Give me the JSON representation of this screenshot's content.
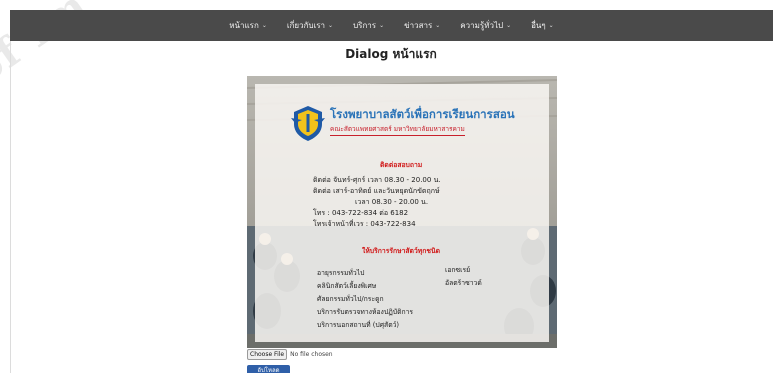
{
  "navbar": {
    "items": [
      {
        "label": "หน้าแรก",
        "caret": "⌄"
      },
      {
        "label": "เกี่ยวกับเรา",
        "caret": "⌄"
      },
      {
        "label": "บริการ",
        "caret": "⌄"
      },
      {
        "label": "ข่าวสาร",
        "caret": "⌄"
      },
      {
        "label": "ความรู้ทั่วไป",
        "caret": "⌄"
      },
      {
        "label": "อื่นๆ",
        "caret": "⌄"
      }
    ]
  },
  "page": {
    "title": "Dialog หน้าแรก",
    "watermark": "of Im"
  },
  "poster": {
    "hospital_name": "โรงพยาบาลสัตว์เพื่อการเรียนการสอน",
    "faculty_name": "คณะสัตวแพทยศาสตร์ มหาวิทยาลัยมหาสารคาม",
    "contact_heading": "ติดต่อสอบถาม",
    "contact_lines": [
      "ติดต่อ จันทร์-ศุกร์ เวลา 08.30 - 20.00 น.",
      "ติดต่อ เสาร์-อาทิตย์ และวันหยุดนักขัตฤกษ์",
      "เวลา 08.30 - 20.00 น.",
      "โทร : 043-722-834 ต่อ 6182",
      "โทรเจ้าหน้าที่เวร : 043-722-834"
    ],
    "services_heading": "ให้บริการรักษาสัตว์ทุกชนิด",
    "services_left": [
      "อายุรกรรมทั่วไป",
      "คลินิกสัตว์เลี้ยงพิเศษ",
      "ศัลยกรรมทั่วไป/กระดูก",
      "บริการรับตรวจทางห้องปฏิบัติการ",
      "บริการนอกสถานที่ (ปศุสัตว์)"
    ],
    "services_right": [
      "เอกซเรย์",
      "อัลตร้าซาวด์"
    ]
  },
  "file_input": {
    "button_label": "Choose File",
    "status": "No file chosen"
  },
  "upload_button": {
    "label": "อัปโหลด"
  },
  "colors": {
    "navbar_bg": "#4a4a4a",
    "hospital_name": "#2a73b8",
    "accent_red": "#d11a1a",
    "upload_button": "#2f5fa8"
  }
}
